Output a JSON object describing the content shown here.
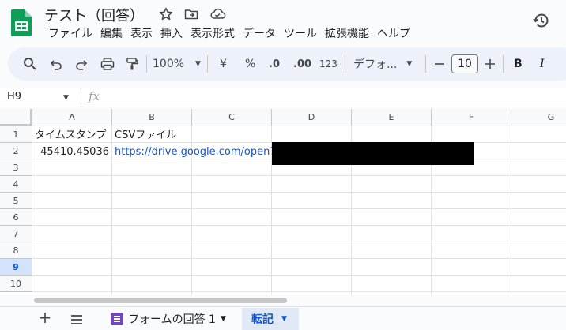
{
  "app": {
    "doc_title": "テスト（回答）",
    "menus": [
      "ファイル",
      "編集",
      "表示",
      "挿入",
      "表示形式",
      "データ",
      "ツール",
      "拡張機能",
      "ヘルプ"
    ]
  },
  "toolbar": {
    "zoom": "100%",
    "currency": "¥",
    "percent": "%",
    "decimal_decrease": ".0",
    "decimal_increase": ".00",
    "number_format": "123",
    "font_name": "デフォ...",
    "font_size": "10",
    "bold": "B",
    "italic": "I"
  },
  "formula_bar": {
    "name_box": "H9",
    "fx": "fx"
  },
  "grid": {
    "columns": [
      "A",
      "B",
      "C",
      "D",
      "E",
      "F",
      "G"
    ],
    "rows": [
      "1",
      "2",
      "3",
      "4",
      "5",
      "6",
      "7",
      "8",
      "9",
      "10"
    ],
    "selected_row": "9",
    "cells": {
      "A1": "タイムスタンプ",
      "B1": "CSVファイル",
      "A2": "45410.45036",
      "B2": "https://drive.google.com/open?id="
    }
  },
  "sheet_tabs": {
    "tabs": [
      {
        "label": "フォームの回答 1",
        "active": false
      },
      {
        "label": "転記",
        "active": true
      }
    ]
  },
  "colors": {
    "accent": "#0b57d0",
    "logo_green": "#0f9d58",
    "form_purple": "#7248b9",
    "toolbar_bg": "#edf2fa",
    "link": "#1155cc"
  },
  "icons": {
    "title_bar": [
      "star-icon",
      "move-to-folder-icon",
      "cloud-saved-icon"
    ],
    "history": "version-history-icon",
    "toolbar": [
      "search-icon",
      "undo-icon",
      "redo-icon",
      "print-icon",
      "paint-format-icon",
      "minus-icon",
      "plus-icon"
    ]
  }
}
